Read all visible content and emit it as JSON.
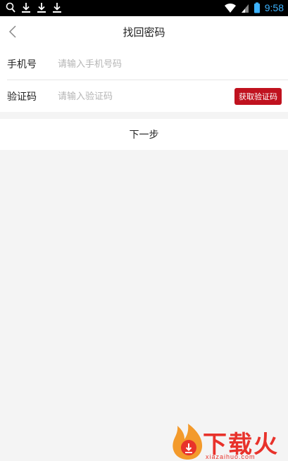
{
  "status_bar": {
    "time": "9:58",
    "icons": [
      "search-icon",
      "download-icon",
      "download-icon",
      "download-icon",
      "wifi-icon",
      "signal-icon",
      "battery-icon"
    ]
  },
  "header": {
    "title": "找回密码",
    "back_icon": "chevron-left-icon"
  },
  "form": {
    "phone_label": "手机号",
    "phone_placeholder": "请输入手机号码",
    "code_label": "验证码",
    "code_placeholder": "请输入验证码",
    "get_code_label": "获取验证码"
  },
  "next_label": "下一步",
  "watermark": {
    "text": "下载火",
    "sub": "xiazaihuo.com"
  },
  "colors": {
    "accent": "#c0121f",
    "background": "#f4f4f4",
    "status_time": "#3db3ff",
    "watermark": "#e8322b"
  }
}
